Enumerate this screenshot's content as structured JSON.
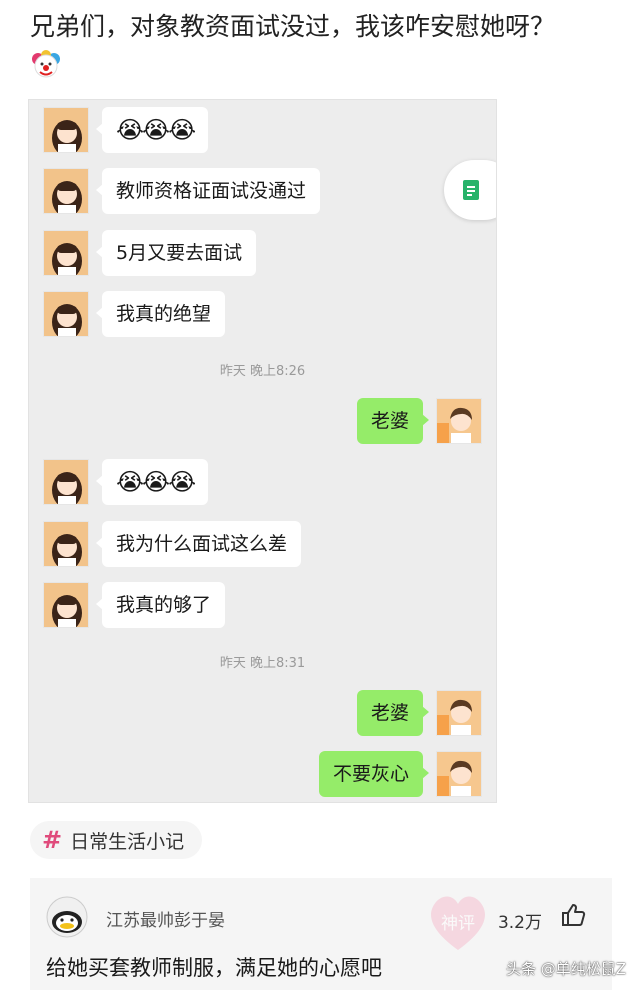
{
  "post": {
    "title": "兄弟们，对象教资面试没过，我该咋安慰她呀？",
    "title_emoji_icon": "clown-icon"
  },
  "chat": {
    "messages": [
      {
        "side": "left",
        "text": "😭😭😭"
      },
      {
        "side": "left",
        "text": "教师资格证面试没通过"
      },
      {
        "side": "left",
        "text": "5月又要去面试"
      },
      {
        "side": "left",
        "text": "我真的绝望"
      },
      {
        "side": "time",
        "text": "昨天 晚上8:26"
      },
      {
        "side": "right",
        "text": "老婆"
      },
      {
        "side": "left",
        "text": "😭😭😭"
      },
      {
        "side": "left",
        "text": "我为什么面试这么差"
      },
      {
        "side": "left",
        "text": "我真的够了"
      },
      {
        "side": "time",
        "text": "昨天 晚上8:31"
      },
      {
        "side": "right",
        "text": "老婆"
      },
      {
        "side": "right",
        "text": "不要灰心"
      }
    ],
    "floating_button_icon": "document-icon",
    "colors": {
      "background": "#ededed",
      "sent_bubble": "#95ec69",
      "received_bubble": "#ffffff"
    }
  },
  "tag": {
    "hash": "#",
    "label": "日常生活小记"
  },
  "comment": {
    "username": "江苏最帅彭于晏",
    "likes": "3.2万",
    "text": "给她买套教师制服，满足她的心愿吧",
    "stamp_text": "神评",
    "like_icon": "thumbs-up-icon"
  },
  "watermark": "头条 @单纯松鼠Z"
}
